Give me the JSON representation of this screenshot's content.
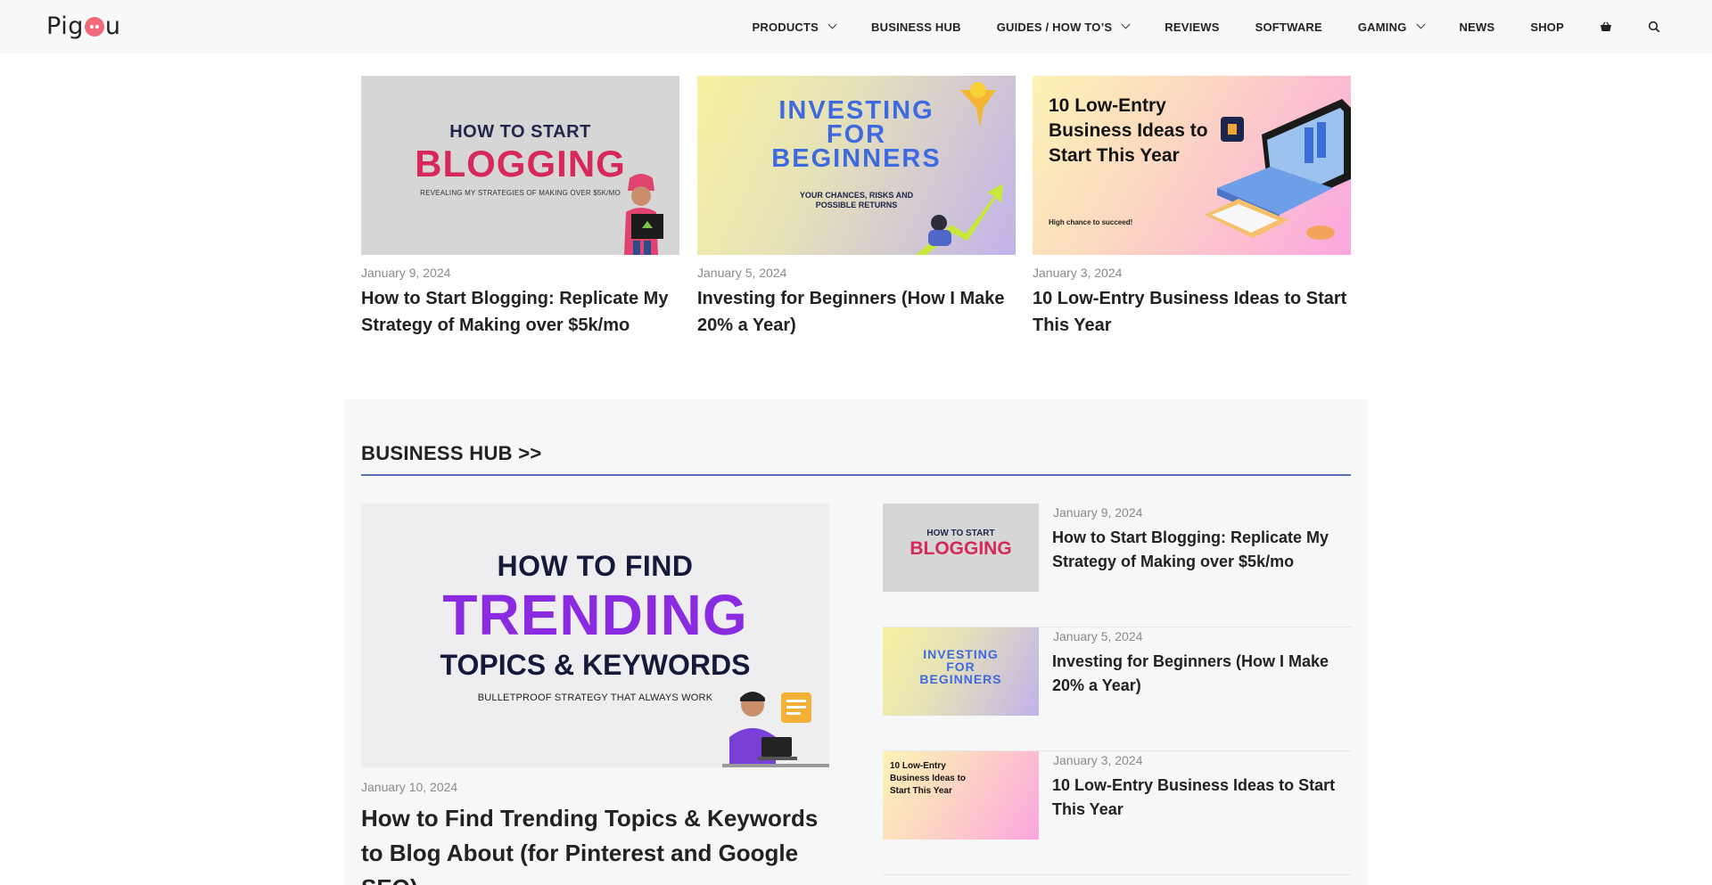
{
  "header": {
    "logo_left": "Pig",
    "logo_right": "u",
    "nav": [
      {
        "label": "PRODUCTS",
        "dropdown": true
      },
      {
        "label": "BUSINESS HUB",
        "dropdown": false
      },
      {
        "label": "GUIDES / HOW TO’S",
        "dropdown": true
      },
      {
        "label": "REVIEWS",
        "dropdown": false
      },
      {
        "label": "SOFTWARE",
        "dropdown": false
      },
      {
        "label": "GAMING",
        "dropdown": true
      },
      {
        "label": "NEWS",
        "dropdown": false
      },
      {
        "label": "SHOP",
        "dropdown": false
      }
    ],
    "icons": [
      "basket-icon",
      "search-icon"
    ]
  },
  "top_posts": [
    {
      "date": "January 9, 2024",
      "title": "How to Start Blogging: Replicate My Strategy of Making over $5k/mo",
      "thumb": {
        "line1": "HOW TO START",
        "line2": "BLOGGING",
        "line3": "REVEALING MY STRATEGIES OF MAKING OVER $5K/MO"
      }
    },
    {
      "date": "January 5, 2024",
      "title": "Investing for Beginners (How I Make 20% a Year)",
      "thumb": {
        "line1": "INVESTING FOR BEGINNERS",
        "line2": "YOUR CHANCES, RISKS AND POSSIBLE RETURNS"
      }
    },
    {
      "date": "January 3, 2024",
      "title": "10 Low-Entry Business Ideas to Start This Year",
      "thumb": {
        "line1": "10 Low-Entry Business Ideas to Start This Year",
        "line2": "High chance to succeed!"
      }
    }
  ],
  "business_hub": {
    "heading": "BUSINESS HUB >>",
    "accent_color": "#5b6fb8",
    "featured": {
      "date": "January 10, 2024",
      "title": "How to Find Trending Topics & Keywords to Blog About (for Pinterest and Google SEO)",
      "thumb": {
        "line1": "HOW TO FIND",
        "line2": "TRENDING",
        "line3": "TOPICS & KEYWORDS",
        "line4": "BULLETPROOF STRATEGY THAT ALWAYS WORK"
      }
    },
    "list": [
      {
        "date": "January 9, 2024",
        "title": "How to Start Blogging: Replicate My Strategy of Making over $5k/mo",
        "thumb_a": "HOW TO START",
        "thumb_b": "BLOGGING"
      },
      {
        "date": "January 5, 2024",
        "title": "Investing for Beginners (How I Make 20% a Year)",
        "thumb_a": "INVESTING FOR BEGINNERS"
      },
      {
        "date": "January 3, 2024",
        "title": "10 Low-Entry Business Ideas to Start This Year",
        "thumb_a": "10 Low-Entry Business Ideas to Start This Year"
      }
    ]
  }
}
